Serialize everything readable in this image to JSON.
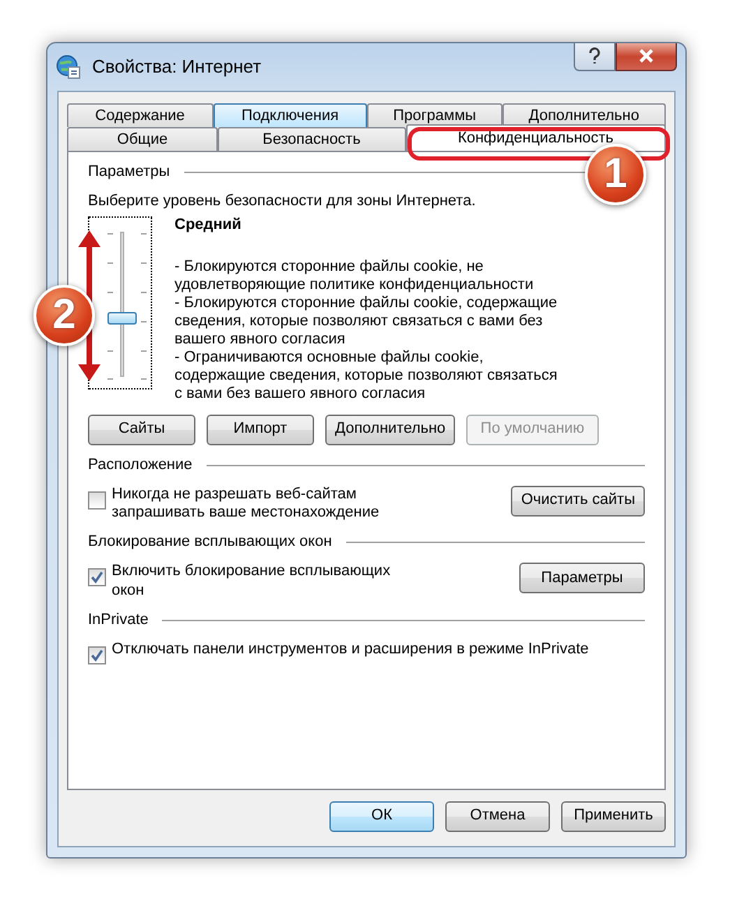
{
  "window": {
    "title": "Свойства: Интернет"
  },
  "tab_rows": [
    [
      {
        "label": "Содержание",
        "selected": false,
        "hovered": false
      },
      {
        "label": "Подключения",
        "selected": false,
        "hovered": true
      },
      {
        "label": "Программы",
        "selected": false,
        "hovered": false
      },
      {
        "label": "Дополнительно",
        "selected": false,
        "hovered": false
      }
    ],
    [
      {
        "label": "Общие",
        "selected": false,
        "hovered": false
      },
      {
        "label": "Безопасность",
        "selected": false,
        "hovered": false
      },
      {
        "label": "Конфиденциальность",
        "selected": true,
        "hovered": false
      }
    ]
  ],
  "settings": {
    "heading": "Параметры",
    "prompt": "Выберите уровень безопасности для зоны Интернета.",
    "slider": {
      "level": 0.4
    },
    "level_name": "Средний",
    "description": [
      "- Блокируются сторонние файлы cookie, не удовлетворяющие политике конфиденциальности",
      "- Блокируются сторонние файлы cookie, содержащие сведения, которые позволяют связаться с вами без вашего явного согласия",
      "- Ограничиваются основные файлы cookie, содержащие сведения, которые позволяют связаться с вами без вашего явного согласия"
    ],
    "buttons": [
      {
        "label": "Сайты",
        "disabled": false
      },
      {
        "label": "Импорт",
        "disabled": false
      },
      {
        "label": "Дополнительно",
        "disabled": false
      },
      {
        "label": "По умолчанию",
        "disabled": true
      }
    ]
  },
  "sections": [
    {
      "heading": "Расположение",
      "checkbox": {
        "label": "Никогда не разрешать веб-сайтам запрашивать ваше местонахождение",
        "checked": false
      },
      "button": "Очистить сайты"
    },
    {
      "heading": "Блокирование всплывающих окон",
      "checkbox": {
        "label": "Включить блокирование всплывающих окон",
        "checked": true
      },
      "button": "Параметры"
    },
    {
      "heading": "InPrivate",
      "checkbox": {
        "label": "Отключать панели инструментов и расширения в режиме InPrivate",
        "checked": true
      }
    }
  ],
  "footer_buttons": [
    {
      "label": "ОК",
      "default": true
    },
    {
      "label": "Отмена",
      "default": false
    },
    {
      "label": "Применить",
      "default": false
    }
  ],
  "callouts": [
    {
      "label": "1"
    },
    {
      "label": "2"
    }
  ]
}
